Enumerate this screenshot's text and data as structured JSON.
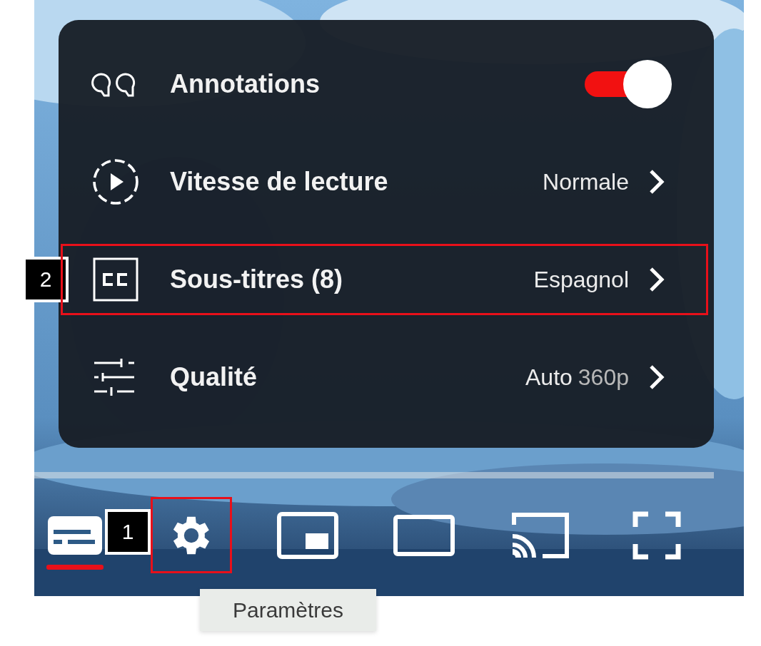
{
  "menu": {
    "items": [
      {
        "kind": "toggle",
        "label": "Annotations",
        "on": true,
        "highlighted": false
      },
      {
        "kind": "submenu",
        "label": "Vitesse de lecture",
        "value": "Normale",
        "highlighted": false
      },
      {
        "kind": "submenu",
        "label": "Sous-titres (8)",
        "value": "Espagnol",
        "highlighted": true,
        "callout": "2"
      },
      {
        "kind": "submenu",
        "label": "Qualité",
        "value": "Auto",
        "value_detail": "360p",
        "highlighted": false
      }
    ]
  },
  "controls": [
    {
      "kind": "subtitles",
      "on": true,
      "highlighted": false
    },
    {
      "kind": "settings",
      "highlighted": true,
      "callout": "1"
    },
    {
      "kind": "miniplayer",
      "highlighted": false
    },
    {
      "kind": "theater",
      "highlighted": false
    },
    {
      "kind": "cast",
      "highlighted": false
    },
    {
      "kind": "fullscreen",
      "highlighted": false
    }
  ],
  "tooltip": "Paramètres"
}
